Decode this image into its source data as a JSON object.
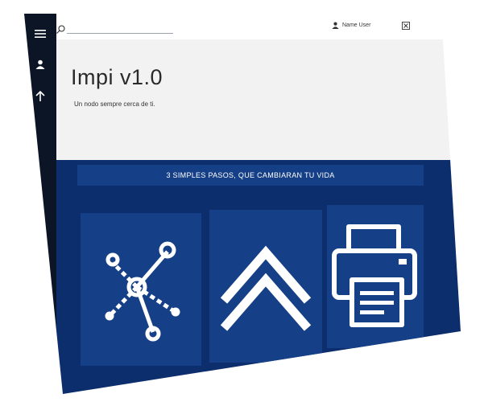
{
  "app": {
    "title": "Impi v1.0",
    "subtitle": "Un nodo sempre cerca de ti."
  },
  "sidebar": {
    "items": [
      {
        "icon": "menu-icon"
      },
      {
        "icon": "user-icon"
      },
      {
        "icon": "arrow-up-icon"
      }
    ]
  },
  "topbar": {
    "search": {
      "value": "",
      "placeholder": ""
    },
    "user_name": "Name User",
    "close_icon": "close-icon"
  },
  "banner": {
    "text": "3 SIMPLES PASOS, QUE CAMBIARAN TU VIDA"
  },
  "tiles": [
    {
      "icon": "network-nodes-icon"
    },
    {
      "icon": "double-chevron-up-icon"
    },
    {
      "icon": "printer-icon"
    }
  ],
  "colors": {
    "sidebar": "#0b1526",
    "panel": "#0d2e6c",
    "tile": "#153f86",
    "hero_bg": "#f2f2f2"
  }
}
